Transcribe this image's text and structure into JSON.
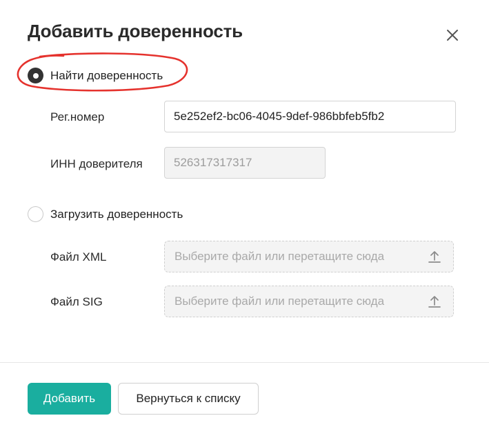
{
  "dialog": {
    "title": "Добавить доверенность",
    "close_icon": "close-icon"
  },
  "find_option": {
    "label": "Найти доверенность",
    "selected": true,
    "highlight_color": "#e5322d"
  },
  "find_fields": {
    "reg_label": "Рег.номер",
    "reg_value": "5e252ef2-bc06-4045-9def-986bbfeb5fb2",
    "inn_label": "ИНН доверителя",
    "inn_value": "526317317317"
  },
  "upload_option": {
    "label": "Загрузить доверенность",
    "selected": false
  },
  "upload_fields": {
    "xml_label": "Файл XML",
    "xml_placeholder": "Выберите файл или перетащите сюда",
    "sig_label": "Файл SIG",
    "sig_placeholder": "Выберите файл или перетащите сюда",
    "upload_icon": "upload-icon"
  },
  "footer": {
    "add_label": "Добавить",
    "back_label": "Вернуться к списку"
  },
  "colors": {
    "primary": "#1aae9f",
    "radio_checked": "#333333",
    "input_border": "#d3d3d3",
    "disabled_bg": "#f3f3f3"
  }
}
